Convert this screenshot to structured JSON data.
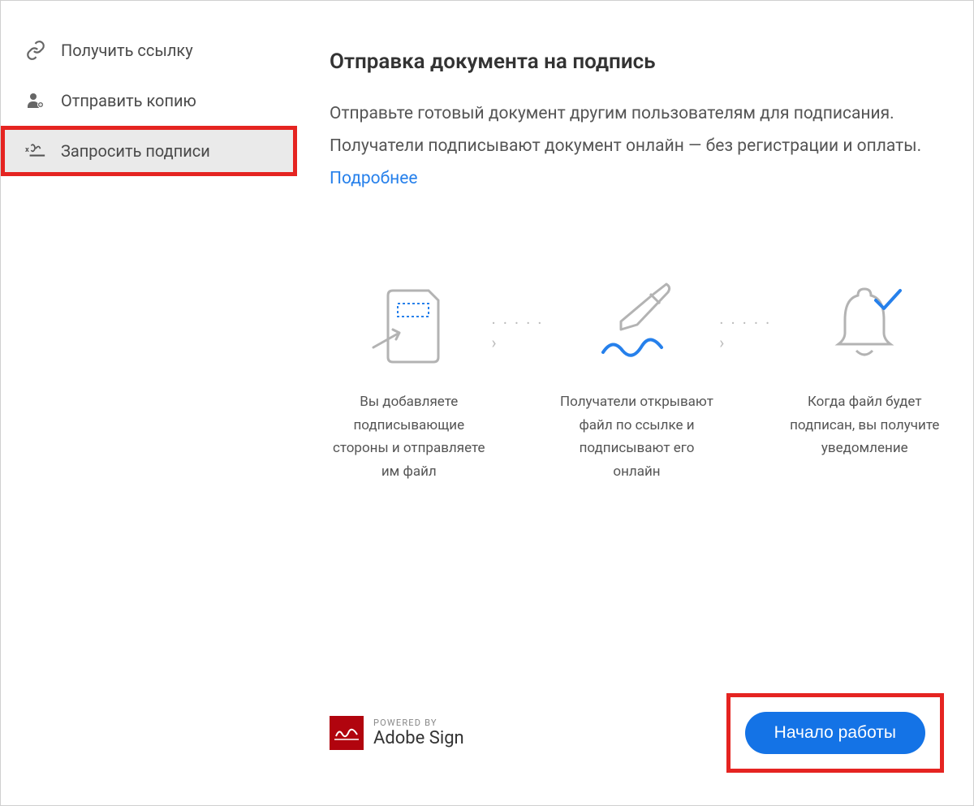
{
  "sidebar": {
    "items": [
      {
        "label": "Получить ссылку",
        "icon": "link-icon"
      },
      {
        "label": "Отправить копию",
        "icon": "share-person-icon"
      },
      {
        "label": "Запросить подписи",
        "icon": "signature-icon"
      }
    ]
  },
  "main": {
    "heading": "Отправка документа на подпись",
    "description_part1": "Отправьте готовый документ другим пользователям для подписания. Получатели подписывают документ онлайн — без регистрации и оплаты. ",
    "link_label": "Подробнее",
    "steps": [
      {
        "text": "Вы добавляете подписывающие стороны и отправляете им файл"
      },
      {
        "text": "Получатели открывают файл по ссылке и подписывают его онлайн"
      },
      {
        "text": "Когда файл будет подписан, вы получите уведомление"
      }
    ],
    "dots": "· · · · · ›"
  },
  "footer": {
    "powered_label": "POWERED BY",
    "brand_name": "Adobe Sign",
    "cta_label": "Начало работы"
  }
}
